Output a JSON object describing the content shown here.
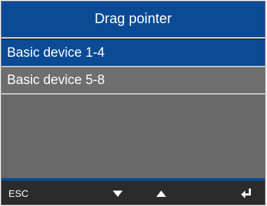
{
  "title": "Drag pointer",
  "menu": {
    "items": [
      {
        "label": "Basic device 1-4",
        "selected": true
      },
      {
        "label": "Basic device 5-8",
        "selected": false
      }
    ]
  },
  "softkeys": {
    "esc_label": "ESC",
    "down_icon": "triangle-down-icon",
    "up_icon": "triangle-up-icon",
    "enter_icon": "enter-return-icon"
  },
  "colors": {
    "accent": "#0b4b95",
    "list_background": "#6e6e6e",
    "footer_background": "#2b2b2b",
    "text": "#ffffff"
  }
}
